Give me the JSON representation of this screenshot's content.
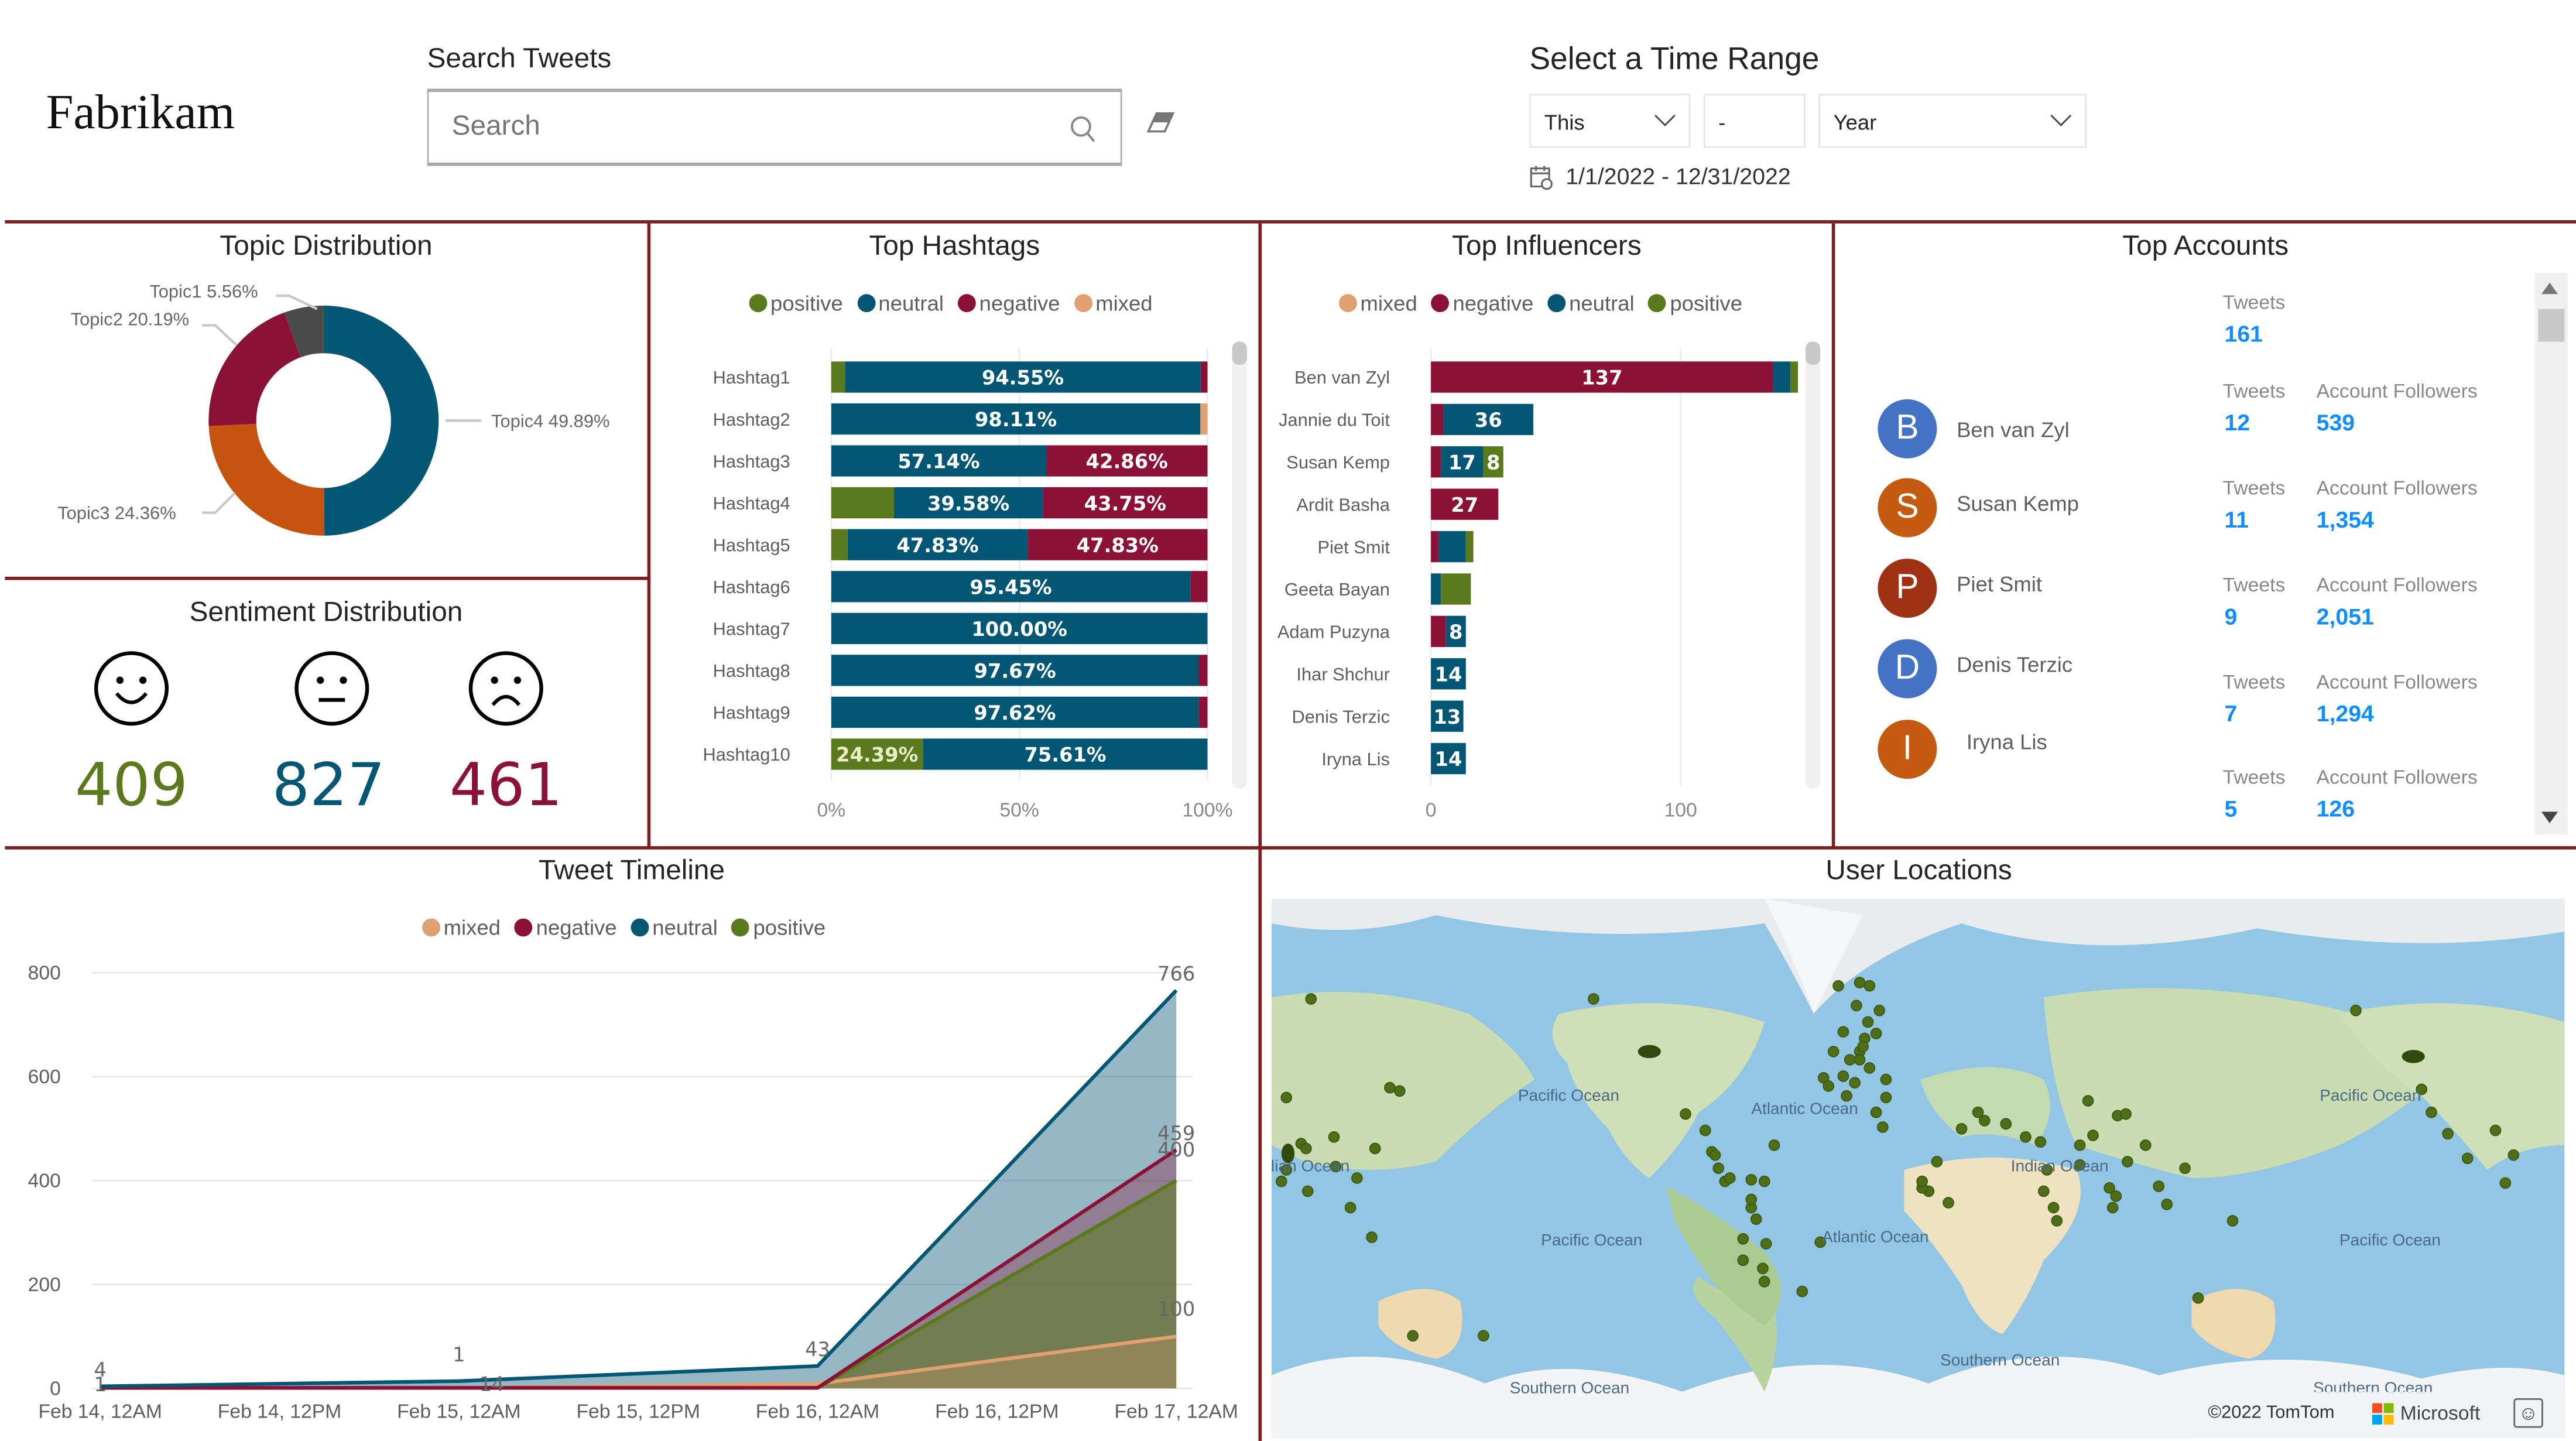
{
  "header": {
    "logo": "Fabrikam",
    "search": {
      "label": "Search Tweets",
      "placeholder": "Search",
      "value": ""
    },
    "time_range": {
      "label": "Select a Time Range",
      "relative": "This",
      "count": "-",
      "unit": "Year",
      "date_range": "1/1/2022 - 12/31/2022"
    }
  },
  "colors": {
    "positive": "#5b7a1e",
    "neutral": "#045675",
    "negative": "#8c1136",
    "mixed": "#e0a070",
    "topic1": "#4b4b4b",
    "topic2": "#8c1136",
    "topic3": "#c65410",
    "topic4": "#045675",
    "panel_border": "#7a1f1f",
    "value_blue": "#118dff"
  },
  "topic_distribution": {
    "title": "Topic Distribution",
    "chart_data": {
      "type": "pie",
      "subtype": "donut",
      "slices": [
        {
          "label": "Topic4",
          "value": 49.89,
          "text": "Topic4 49.89%"
        },
        {
          "label": "Topic3",
          "value": 24.36,
          "text": "Topic3 24.36%"
        },
        {
          "label": "Topic2",
          "value": 20.19,
          "text": "Topic2 20.19%"
        },
        {
          "label": "Topic1",
          "value": 5.56,
          "text": "Topic1 5.56%"
        }
      ]
    }
  },
  "sentiment_distribution": {
    "title": "Sentiment Distribution",
    "items": [
      {
        "name": "positive",
        "icon": "smile-face-icon",
        "value": "409"
      },
      {
        "name": "neutral",
        "icon": "neutral-face-icon",
        "value": "827"
      },
      {
        "name": "negative",
        "icon": "sad-face-icon",
        "value": "461"
      }
    ]
  },
  "top_hashtags": {
    "title": "Top Hashtags",
    "legend": [
      "positive",
      "neutral",
      "negative",
      "mixed"
    ],
    "chart_data": {
      "type": "bar",
      "orientation": "horizontal",
      "stacked": "100%",
      "categories": [
        "Hashtag1",
        "Hashtag2",
        "Hashtag3",
        "Hashtag4",
        "Hashtag5",
        "Hashtag6",
        "Hashtag7",
        "Hashtag8",
        "Hashtag9",
        "Hashtag10"
      ],
      "series": [
        {
          "name": "positive",
          "values": [
            3.64,
            0,
            0,
            16.67,
            4.34,
            0,
            0,
            0,
            0,
            24.39
          ]
        },
        {
          "name": "neutral",
          "values": [
            94.55,
            98.11,
            57.14,
            39.58,
            47.83,
            95.45,
            100.0,
            97.67,
            97.62,
            75.61
          ]
        },
        {
          "name": "negative",
          "values": [
            1.81,
            0,
            42.86,
            43.75,
            47.83,
            4.55,
            0,
            2.33,
            2.38,
            0
          ]
        },
        {
          "name": "mixed",
          "values": [
            0,
            1.89,
            0,
            0,
            0,
            0,
            0,
            0,
            0,
            0
          ]
        }
      ],
      "data_labels": [
        [
          null,
          "94.55%",
          null,
          null
        ],
        [
          null,
          "98.11%",
          null,
          null
        ],
        [
          null,
          "57.14%",
          "42.86%",
          null
        ],
        [
          null,
          "39.58%",
          "43.75%",
          null
        ],
        [
          null,
          "47.83%",
          "47.83%",
          null
        ],
        [
          null,
          "95.45%",
          null,
          null
        ],
        [
          null,
          "100.00%",
          null,
          null
        ],
        [
          null,
          "97.67%",
          null,
          null
        ],
        [
          null,
          "97.62%",
          null,
          null
        ],
        [
          "24.39%",
          "75.61%",
          null,
          null
        ]
      ],
      "xticks": [
        "0%",
        "50%",
        "100%"
      ],
      "xlim": [
        0,
        100
      ]
    }
  },
  "top_influencers": {
    "title": "Top Influencers",
    "legend": [
      "mixed",
      "negative",
      "neutral",
      "positive"
    ],
    "chart_data": {
      "type": "bar",
      "orientation": "horizontal",
      "stacked": true,
      "categories": [
        "Ben van Zyl",
        "Jannie du Toit",
        "Susan Kemp",
        "Ardit Basha",
        "Piet Smit",
        "Geeta Bayan",
        "Adam Puzyna",
        "Ihar Shchur",
        "Denis Terzic",
        "Iryna Lis"
      ],
      "series": [
        {
          "name": "mixed",
          "values": [
            0,
            0,
            0,
            0,
            0,
            0,
            0,
            0,
            0,
            0
          ]
        },
        {
          "name": "negative",
          "values": [
            137,
            5,
            4,
            27,
            3,
            0,
            6,
            0,
            0,
            0
          ]
        },
        {
          "name": "neutral",
          "values": [
            7,
            36,
            17,
            0,
            11,
            4,
            8,
            14,
            13,
            14
          ]
        },
        {
          "name": "positive",
          "values": [
            3,
            0,
            8,
            0,
            3,
            12,
            0,
            0,
            0,
            0
          ]
        }
      ],
      "data_labels": [
        [
          null,
          "137",
          null,
          null
        ],
        [
          null,
          null,
          "36",
          null
        ],
        [
          null,
          null,
          "17",
          "8"
        ],
        [
          null,
          "27",
          null,
          null
        ],
        [
          null,
          null,
          null,
          null
        ],
        [
          null,
          null,
          null,
          null
        ],
        [
          null,
          null,
          "8",
          null
        ],
        [
          null,
          null,
          "14",
          null
        ],
        [
          null,
          null,
          "13",
          null
        ],
        [
          null,
          null,
          "14",
          null
        ]
      ],
      "xticks": [
        "0",
        "100"
      ],
      "xlim": [
        0,
        150
      ]
    }
  },
  "top_accounts": {
    "title": "Top Accounts",
    "tweets_label": "Tweets",
    "followers_label": "Account Followers",
    "summary_tweets": "161",
    "accounts": [
      {
        "initial": "B",
        "name": "Ben van Zyl",
        "color": "#4472c4",
        "tweets": "12",
        "followers": "539"
      },
      {
        "initial": "S",
        "name": "Susan Kemp",
        "color": "#c55a11",
        "tweets": "11",
        "followers": "1,354"
      },
      {
        "initial": "P",
        "name": "Piet Smit",
        "color": "#9e3212",
        "tweets": "9",
        "followers": "2,051"
      },
      {
        "initial": "D",
        "name": "Denis Terzic",
        "color": "#4472c4",
        "tweets": "7",
        "followers": "1,294"
      },
      {
        "initial": "I",
        "name": "Iryna Lis",
        "color": "#c55a11",
        "tweets": "5",
        "followers": "126"
      }
    ]
  },
  "tweet_timeline": {
    "title": "Tweet Timeline",
    "legend": [
      "mixed",
      "negative",
      "neutral",
      "positive"
    ],
    "chart_data": {
      "type": "area",
      "x": [
        "Feb 14, 12AM",
        "Feb 15, 12AM",
        "Feb 16, 12AM",
        "Feb 17, 12AM"
      ],
      "x_ticks": [
        "Feb 14, 12AM",
        "Feb 14, 12PM",
        "Feb 15, 12AM",
        "Feb 15, 12PM",
        "Feb 16, 12AM",
        "Feb 16, 12PM",
        "Feb 17, 12AM"
      ],
      "series": [
        {
          "name": "neutral",
          "values": [
            4,
            14,
            43,
            766
          ]
        },
        {
          "name": "negative",
          "values": [
            1,
            1,
            1,
            459
          ]
        },
        {
          "name": "positive",
          "values": [
            1,
            1,
            1,
            400
          ]
        },
        {
          "name": "mixed",
          "values": [
            1,
            1,
            9,
            100
          ]
        }
      ],
      "point_labels": [
        {
          "x": "Feb 14, 12AM",
          "text": "4"
        },
        {
          "x": "Feb 14, 12AM",
          "text": "1"
        },
        {
          "x": "Feb 15, 12AM",
          "text": "1"
        },
        {
          "x": "Feb 15, 12AM",
          "text": "14"
        },
        {
          "x": "Feb 16, 12AM",
          "text": "43"
        },
        {
          "x": "Feb 17, 12AM",
          "text": "766"
        },
        {
          "x": "Feb 17, 12AM",
          "text": "459"
        },
        {
          "x": "Feb 17, 12AM",
          "text": "400"
        },
        {
          "x": "Feb 17, 12AM",
          "text": "100"
        }
      ],
      "yticks": [
        "0",
        "200",
        "400",
        "600",
        "800"
      ],
      "ylim": [
        0,
        800
      ],
      "grid": true,
      "legend_position": "top-center"
    }
  },
  "user_locations": {
    "title": "User Locations",
    "ocean_labels": [
      "Pacific Ocean",
      "Atlantic Ocean",
      "Indian Ocean",
      "Pacific Ocean",
      "Atlantic Ocean",
      "Pacific Ocean",
      "Pacific Ocean",
      "Southern Ocean",
      "Southern Ocean",
      "Southern Ocean",
      "Indian Ocean"
    ],
    "attribution": "©2022 TomTom",
    "brand": "Microsoft"
  }
}
